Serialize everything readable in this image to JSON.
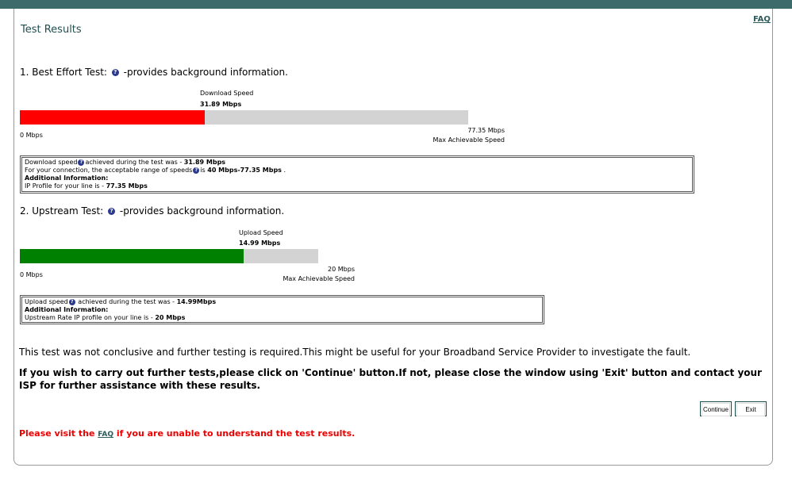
{
  "header": {
    "title": "Test Results",
    "faq_link": "FAQ"
  },
  "download": {
    "heading_prefix": "1. Best Effort Test:",
    "heading_suffix": "-provides background information.",
    "label": "Download Speed",
    "value": "31.89 Mbps",
    "speed_mbps": 31.89,
    "max_mbps": 77.35,
    "min_label": "0 Mbps",
    "max_label": "77.35 Mbps",
    "max_caption": "Max Achievable Speed",
    "color": "#ff0000",
    "info": {
      "line1_prefix": "Download speed",
      "line1_mid": "achieved during the test was - ",
      "line1_value": "31.89 Mbps",
      "line2_prefix": "For your connection, the acceptable range of speeds",
      "line2_mid": "is ",
      "line2_value": "40 Mbps-77.35 Mbps",
      "line2_end": " .",
      "additional": "Additional Information:",
      "line4_prefix": "IP Profile for your line is - ",
      "line4_value": "77.35 Mbps"
    }
  },
  "upload": {
    "heading_prefix": "2. Upstream Test:",
    "heading_suffix": "-provides background information.",
    "label": "Upload Speed",
    "value": "14.99 Mbps",
    "speed_mbps": 14.99,
    "max_mbps": 20,
    "min_label": "0 Mbps",
    "max_label": "20 Mbps",
    "max_caption": "Max Achievable Speed",
    "color": "#008000",
    "info": {
      "line1_prefix": "Upload speed",
      "line1_mid": " achieved during the test was - ",
      "line1_value": "14.99Mbps",
      "additional": "Additional Information:",
      "line3_prefix": "Upstream Rate IP profile on your line is - ",
      "line3_value": "20 Mbps"
    }
  },
  "messages": {
    "inconclusive": "This test was not conclusive and further testing is required.This might be useful for your Broadband Service Provider to investigate the fault.",
    "instructions": "If you wish to carry out further tests,please click on 'Continue' button.If not, please close the window using 'Exit' button and contact your ISP for further assistance with these results.",
    "faq_prefix": "Please visit the ",
    "faq_link": "FAQ",
    "faq_suffix": " if you are unable to understand the test results."
  },
  "buttons": {
    "continue": "Continue",
    "exit": "Exit"
  },
  "icons": {
    "help": "question-mark-icon"
  },
  "colors": {
    "topbar": "#3d6b6b",
    "title": "#1f4f4f",
    "error": "#ee0000"
  }
}
